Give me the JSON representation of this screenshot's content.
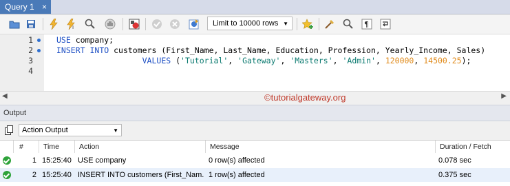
{
  "tab": {
    "title": "Query 1",
    "close": "×"
  },
  "toolbar": {
    "limit_select": "Limit to 10000 rows",
    "icons": [
      "open-folder-icon",
      "save-icon",
      "execute-icon",
      "execute-current-icon",
      "explain-icon",
      "stop-icon",
      "toggle-continue-icon",
      "commit-icon",
      "rollback-icon",
      "autocommit-icon",
      "bookmark-icon",
      "beautify-icon",
      "find-icon",
      "invisible-chars-icon",
      "wrap-icon"
    ]
  },
  "editor": {
    "line_numbers": [
      "1",
      "2",
      "3",
      "4"
    ],
    "lines": [
      {
        "kw1": "USE",
        "rest": " company;"
      },
      {
        "kw1": "INSERT",
        "mid": " ",
        "kw2": "INTO",
        "rest": " customers (First_Name, Last_Name, Education, Profession, Yearly_Income, Sales)"
      },
      {
        "indent": "                  ",
        "kw1": "VALUES",
        "p1": " (",
        "s1": "'Tutorial'",
        "c1": ", ",
        "s2": "'Gateway'",
        "c2": ", ",
        "s3": "'Masters'",
        "c3": ", ",
        "s4": "'Admin'",
        "c4": ", ",
        "n1": "120000",
        "c5": ", ",
        "n2": "14500.25",
        "end": ");"
      }
    ]
  },
  "watermark": "©tutorialgateway.org",
  "output": {
    "title": "Output",
    "selector": "Action Output",
    "columns": [
      "#",
      "Time",
      "Action",
      "Message",
      "Duration / Fetch"
    ],
    "rows": [
      {
        "num": "1",
        "time": "15:25:40",
        "action": "USE company",
        "message": "0 row(s) affected",
        "duration": "0.078 sec"
      },
      {
        "num": "2",
        "time": "15:25:40",
        "action": "INSERT INTO customers (First_Nam...",
        "message": "1 row(s) affected",
        "duration": "0.375 sec"
      }
    ]
  },
  "colors": {
    "tab_active": "#4a7ab8",
    "keyword": "#1d4fc4",
    "string": "#0b7a70",
    "number": "#e08a1a",
    "watermark": "#c03a2b",
    "success": "#2ea33a"
  }
}
